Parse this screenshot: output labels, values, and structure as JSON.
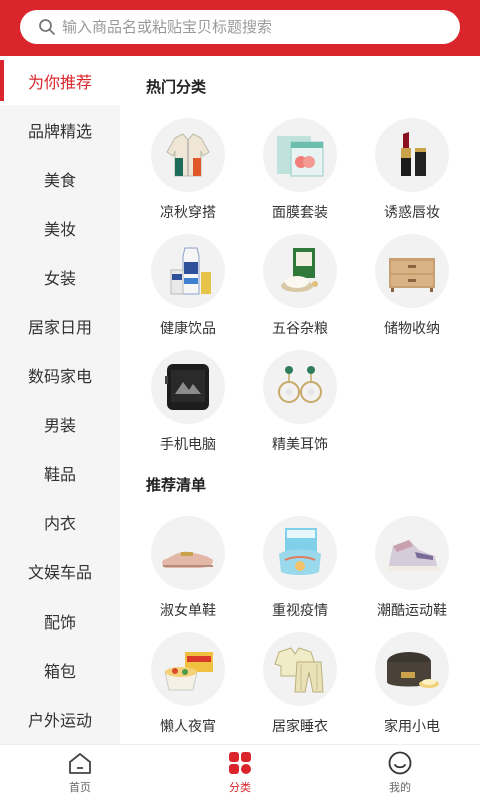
{
  "header": {
    "search_placeholder": "输入商品名或粘贴宝贝标题搜索",
    "brand_color": "#d9252b"
  },
  "sidebar": {
    "items": [
      {
        "label": "为你推荐",
        "active": true
      },
      {
        "label": "品牌精选"
      },
      {
        "label": "美食"
      },
      {
        "label": "美妆"
      },
      {
        "label": "女装"
      },
      {
        "label": "居家日用"
      },
      {
        "label": "数码家电"
      },
      {
        "label": "男装"
      },
      {
        "label": "鞋品"
      },
      {
        "label": "内衣"
      },
      {
        "label": "文娱车品"
      },
      {
        "label": "配饰"
      },
      {
        "label": "箱包"
      },
      {
        "label": "户外运动"
      }
    ]
  },
  "sections": [
    {
      "title": "热门分类",
      "items": [
        {
          "label": "凉秋穿搭",
          "icon": "jacket-icon"
        },
        {
          "label": "面膜套装",
          "icon": "face-mask-box-icon"
        },
        {
          "label": "诱惑唇妆",
          "icon": "lipstick-icon"
        },
        {
          "label": "健康饮品",
          "icon": "drink-carton-icon"
        },
        {
          "label": "五谷杂粮",
          "icon": "rice-bag-icon"
        },
        {
          "label": "储物收纳",
          "icon": "drawer-cabinet-icon"
        },
        {
          "label": "手机电脑",
          "icon": "rugged-phone-icon"
        },
        {
          "label": "精美耳饰",
          "icon": "earrings-icon"
        }
      ]
    },
    {
      "title": "推荐清单",
      "items": [
        {
          "label": "淑女单鞋",
          "icon": "loafer-shoe-icon"
        },
        {
          "label": "重视疫情",
          "icon": "face-masks-icon"
        },
        {
          "label": "潮酷运动鞋",
          "icon": "sneaker-icon"
        },
        {
          "label": "懒人夜宵",
          "icon": "instant-noodles-icon"
        },
        {
          "label": "居家睡衣",
          "icon": "pajamas-icon"
        },
        {
          "label": "家用小电",
          "icon": "rice-cooker-icon"
        }
      ]
    }
  ],
  "tabbar": {
    "tabs": [
      {
        "label": "首页",
        "icon": "home-icon"
      },
      {
        "label": "分类",
        "icon": "category-grid-icon",
        "active": true
      },
      {
        "label": "我的",
        "icon": "profile-smile-icon"
      }
    ]
  }
}
